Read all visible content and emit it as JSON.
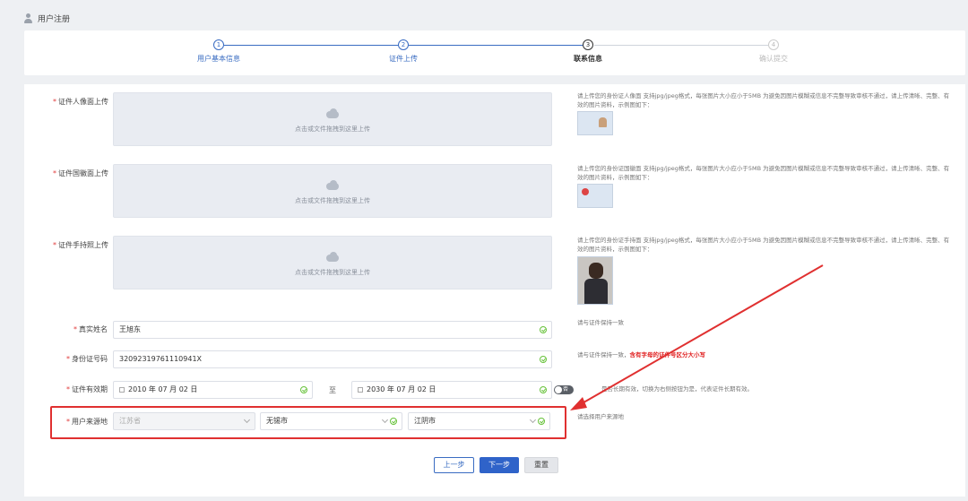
{
  "header": {
    "title": "用户注册"
  },
  "steps": [
    {
      "num": "1",
      "label": "用户基本信息",
      "state": "done"
    },
    {
      "num": "2",
      "label": "证件上传",
      "state": "done"
    },
    {
      "num": "3",
      "label": "联系信息",
      "state": "current"
    },
    {
      "num": "4",
      "label": "确认提交",
      "state": "todo"
    }
  ],
  "uploads": [
    {
      "label": "证件人像面上传",
      "hint": "点击或文件拖拽到这里上传",
      "help": "请上传您的身份证人像面 支持jpg/jpeg格式，每张图片大小应小于5MB 为避免因图片模糊或信息不完整导致审核不通过，请上传清晰、完整、有效的图片资料，示例图如下："
    },
    {
      "label": "证件国徽面上传",
      "hint": "点击或文件拖拽到这里上传",
      "help": "请上传您的身份证国徽面 支持jpg/jpeg格式，每张图片大小应小于5MB 为避免因图片模糊或信息不完整导致审核不通过，请上传清晰、完整、有效的图片资料，示例图如下："
    },
    {
      "label": "证件手持照上传",
      "hint": "点击或文件拖拽到这里上传",
      "help": "请上传您的身份证手持面 支持jpg/jpeg格式，每张图片大小应小于5MB 为避免因图片模糊或信息不完整导致审核不通过，请上传清晰、完整、有效的图片资料，示例图如下：",
      "caption": "请与证件保持一致"
    }
  ],
  "name_field": {
    "label": "真实姓名",
    "value": "王旭东"
  },
  "id_field": {
    "label": "身份证号码",
    "value": "320923197611109​41X",
    "help_prefix": "请与证件保持一致，",
    "help_warning": "含有字母的证件号区分大小写"
  },
  "validity": {
    "label": "证件有效期",
    "start": "2010 年 07 月 02 日",
    "separator": "至",
    "end": "2030 年 07 月 02 日",
    "toggle_label": "否",
    "help": "是否长期有效，切换为右侧按钮为是，代表证件长期有效。"
  },
  "region": {
    "label": "用户来源地",
    "province": "江苏省",
    "city": "无锡市",
    "district": "江阴市",
    "help": "请选择用户来源地"
  },
  "buttons": {
    "prev": "上一步",
    "next": "下一步",
    "reset": "重置"
  },
  "colors": {
    "primary": "#2f63c9",
    "annotation": "#e03030",
    "valid": "#67c23a"
  }
}
